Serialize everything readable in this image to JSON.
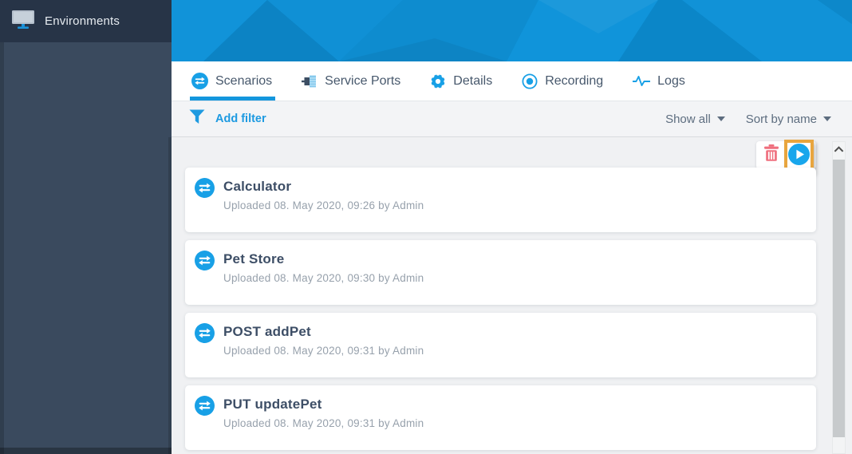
{
  "sidebar": {
    "header": {
      "label": "Environments",
      "icon": "monitor-icon"
    }
  },
  "tabs": {
    "items": [
      {
        "label": "Scenarios",
        "icon": "swap-icon",
        "active": true
      },
      {
        "label": "Service Ports",
        "icon": "port-icon",
        "active": false
      },
      {
        "label": "Details",
        "icon": "gear-icon",
        "active": false
      },
      {
        "label": "Recording",
        "icon": "record-icon",
        "active": false
      },
      {
        "label": "Logs",
        "icon": "pulse-icon",
        "active": false
      }
    ]
  },
  "filterbar": {
    "add_filter_label": "Add filter",
    "filter_icon": "funnel-icon",
    "show_dropdown": {
      "value": "Show all",
      "icon": "caret-down-icon"
    },
    "sort_dropdown": {
      "value": "Sort by name",
      "icon": "caret-down-icon"
    }
  },
  "action_toolbar": {
    "delete_icon": "trash-icon",
    "run_icon": "play-icon",
    "run_highlighted": true
  },
  "scenarios": {
    "item_icon": "swap-icon",
    "items": [
      {
        "name": "Calculator",
        "uploaded": "Uploaded 08. May 2020, 09:26 by Admin"
      },
      {
        "name": "Pet Store",
        "uploaded": "Uploaded 08. May 2020, 09:30 by Admin"
      },
      {
        "name": "POST addPet",
        "uploaded": "Uploaded 08. May 2020, 09:31 by Admin"
      },
      {
        "name": "PUT updatePet",
        "uploaded": "Uploaded 08. May 2020, 09:31 by Admin"
      }
    ]
  },
  "scrollbar": {
    "up_icon": "chevron-up-icon"
  },
  "colors": {
    "accent_blue": "#1496dd",
    "icon_blue": "#18a0e6",
    "banner_blue": "#0d89cc",
    "sidebar_header": "#273447",
    "sidebar_body": "#3a4a5e",
    "danger_red": "#ef6f7e",
    "highlight_orange": "#e8a53e",
    "title_text": "#3d4e66",
    "muted_text": "#97a1ac"
  }
}
